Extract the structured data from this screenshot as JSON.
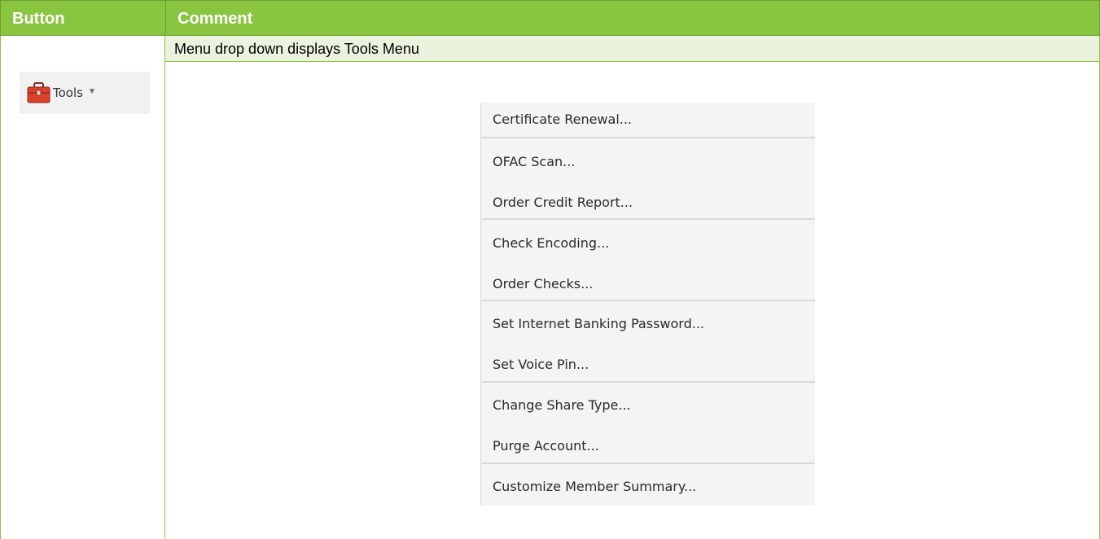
{
  "table": {
    "header": {
      "button": "Button",
      "comment": "Comment"
    },
    "row": {
      "comment_text": "Menu drop down displays Tools Menu"
    }
  },
  "tools_button": {
    "label": "Tools",
    "caret": "▼",
    "icon": "toolbox-icon",
    "icon_color": "#d9412b"
  },
  "tools_menu": {
    "items": [
      "Certificate Renewal...",
      "OFAC Scan...",
      "Order Credit Report...",
      "Check Encoding...",
      "Order Checks...",
      "Set Internet Banking Password...",
      "Set Voice Pin...",
      "Change Share Type...",
      "Purge Account...",
      "Customize Member Summary..."
    ]
  },
  "colors": {
    "header_green": "#8ac53f",
    "row_light_green": "#eaf3de",
    "menu_bg": "#f4f4f4"
  }
}
